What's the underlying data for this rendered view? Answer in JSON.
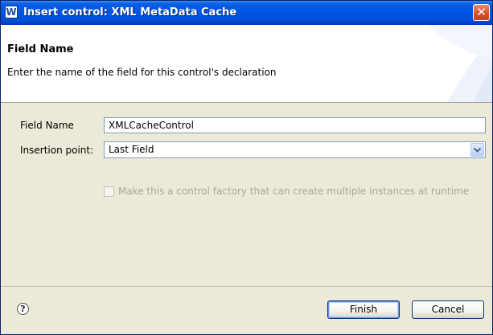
{
  "window": {
    "title": "Insert control: XML MetaData Cache",
    "app_icon": "W",
    "close_glyph": "✕"
  },
  "header": {
    "title": "Field Name",
    "description": "Enter the name of the field for this control's declaration"
  },
  "form": {
    "field_name_label": "Field Name",
    "field_name_value": "XMLCacheControl",
    "insertion_point_label": "Insertion point:",
    "insertion_point_value": "Last Field",
    "factory_checkbox_label": "Make this a control factory that can create multiple instances at runtime",
    "factory_checkbox_checked": false,
    "factory_checkbox_enabled": false
  },
  "footer": {
    "help_glyph": "?",
    "finish_label": "Finish",
    "cancel_label": "Cancel"
  },
  "colors": {
    "titlebar": "#0054e3",
    "dialog_bg": "#ece9d8",
    "header_bg": "#ffffff",
    "disabled_text": "#aca899"
  }
}
